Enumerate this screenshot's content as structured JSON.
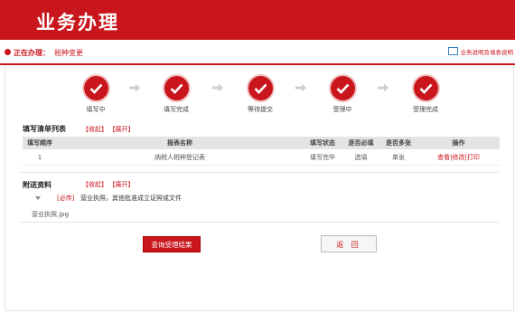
{
  "header": {
    "title": "业务办理"
  },
  "status": {
    "label": "正在办理：",
    "value": "税种变更",
    "help_link": "业务说明及填表说明"
  },
  "steps": [
    {
      "label": "填写中",
      "done": true
    },
    {
      "label": "填写完成",
      "done": true
    },
    {
      "label": "等待提交",
      "done": true
    },
    {
      "label": "受理中",
      "done": true
    },
    {
      "label": "受理完成",
      "done": true
    }
  ],
  "form_list": {
    "title": "填写清单列表",
    "collapse": "【收起】",
    "expand": "【展开】",
    "columns": [
      "填写顺序",
      "报表名称",
      "填写状态",
      "是否必填",
      "是否多张",
      "操作"
    ],
    "rows": [
      {
        "order": "1",
        "name": "纳税人税种登记表",
        "status": "填写完毕",
        "required": "选填",
        "multiple": "单张",
        "action": "查看|修改|打印"
      }
    ]
  },
  "attachments": {
    "title": "附送资料",
    "collapse": "【收起】",
    "expand": "【展开】",
    "required_tag": "[必传]",
    "item_text": "营业执照，其他批准成立证照或文件",
    "file_name": "营业执照.jpg"
  },
  "buttons": {
    "query": "查询受理结果",
    "back": "返 回"
  }
}
